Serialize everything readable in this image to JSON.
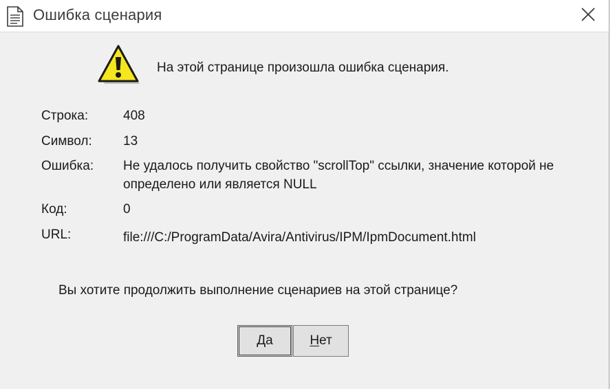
{
  "window": {
    "title": "Ошибка сценария",
    "title_icon": "document-icon",
    "close_icon": "close-icon"
  },
  "message": {
    "icon": "warning-icon",
    "header": "На этой странице произошла ошибка сценария."
  },
  "details": {
    "line_label": "Строка:",
    "line_value": "408",
    "char_label": "Символ:",
    "char_value": "13",
    "error_label": "Ошибка:",
    "error_value": "Не удалось получить свойство \"scrollTop\" ссылки, значение которой не определено или является NULL",
    "code_label": "Код:",
    "code_value": "0",
    "url_label": "URL:",
    "url_value": "file:///C:/ProgramData/Avira/Antivirus/IPM/IpmDocument.html"
  },
  "question": "Вы хотите продолжить выполнение сценариев на этой странице?",
  "buttons": {
    "yes_accel": "Д",
    "yes_rest": "а",
    "no_accel": "Н",
    "no_rest": "ет"
  },
  "colors": {
    "window_bg": "#f0f0f0",
    "warning_fill": "#f5e61d",
    "warning_stroke": "#1a1a1a"
  }
}
